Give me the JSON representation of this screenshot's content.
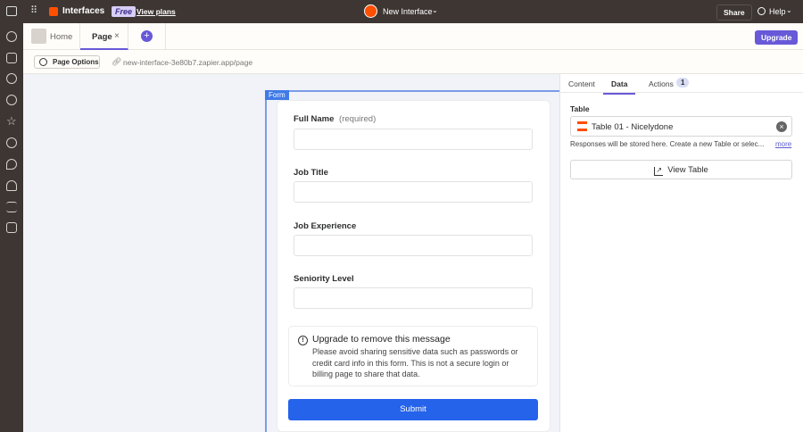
{
  "topbar": {
    "app_name": "Interfaces",
    "plan_badge": "Free",
    "view_plans": "View plans",
    "interface_name": "New Interface",
    "share": "Share",
    "help": "Help"
  },
  "tabs": {
    "home": "Home",
    "page": "Page",
    "upgrade": "Upgrade"
  },
  "toolbar": {
    "page_options": "Page Options",
    "url": "new-interface-3e80b7.zapier.app/page"
  },
  "form": {
    "tag": "Form",
    "fields": [
      {
        "label": "Full Name",
        "hint": "(required)"
      },
      {
        "label": "Job Title"
      },
      {
        "label": "Job Experience"
      },
      {
        "label": "Seniority Level"
      }
    ],
    "notice_title": "Upgrade to remove this message",
    "notice_body": "Please avoid sharing sensitive data such as passwords or credit card info in this form. This is not a secure login or billing page to share that data.",
    "submit": "Submit"
  },
  "panel": {
    "tabs": [
      "Content",
      "Data",
      "Actions"
    ],
    "actions_count": "1",
    "table_label": "Table",
    "table_value": "Table 01 - Nicelydone",
    "helper": "Responses will be stored here. Create a new Table or selec...",
    "more": "more",
    "view_table": "View Table"
  },
  "colors": {
    "accent": "#6759d8",
    "primary": "#2563eb",
    "orange": "#ff4f00"
  }
}
